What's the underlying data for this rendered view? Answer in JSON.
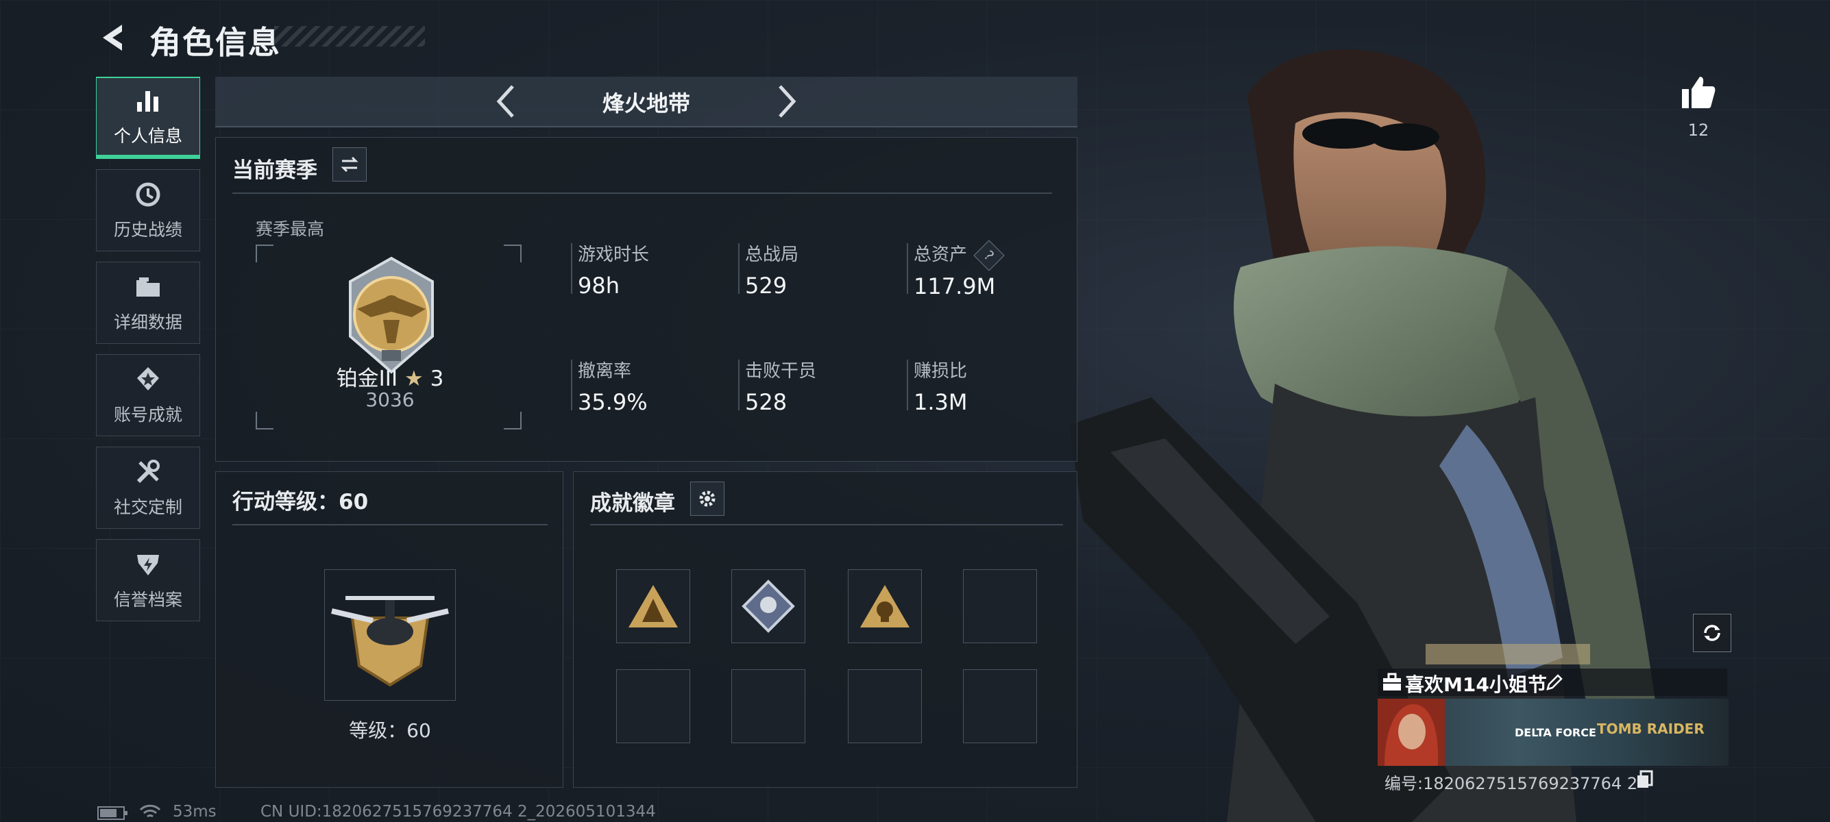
{
  "header": {
    "title": "角色信息"
  },
  "nav": {
    "items": [
      {
        "label": "个人信息",
        "icon": "bar-chart-icon",
        "active": true
      },
      {
        "label": "历史战绩",
        "icon": "history-icon",
        "active": false
      },
      {
        "label": "详细数据",
        "icon": "folder-icon",
        "active": false
      },
      {
        "label": "账号成就",
        "icon": "achievement-icon",
        "active": false
      },
      {
        "label": "社交定制",
        "icon": "tools-icon",
        "active": false
      },
      {
        "label": "信誉档案",
        "icon": "credit-icon",
        "active": false
      }
    ]
  },
  "mode_selector": {
    "title": "烽火地带"
  },
  "season": {
    "title": "当前赛季",
    "best_label": "赛季最高",
    "rank_name": "铂金III",
    "rank_stars": "3",
    "rank_score": "3036",
    "stats": [
      {
        "label": "游戏时长",
        "value": "98h"
      },
      {
        "label": "总战局",
        "value": "529"
      },
      {
        "label": "总资产",
        "value": "117.9M",
        "help": "?"
      },
      {
        "label": "撤离率",
        "value": "35.9%"
      },
      {
        "label": "击败干员",
        "value": "528"
      },
      {
        "label": "赚损比",
        "value": "1.3M"
      }
    ]
  },
  "level": {
    "title": "行动等级：60",
    "label": "等级：60"
  },
  "achievements": {
    "title": "成就徽章",
    "slots_filled": 3,
    "slots_total": 8
  },
  "profile": {
    "likes": "12",
    "nickname": "喜欢M14小姐节",
    "uid": "编号:1820627515769237764 2",
    "banner_text": [
      "DELTA FORCE",
      "TOMB RAIDER"
    ]
  },
  "status_bar": {
    "ping": "53ms",
    "uid_line": "CN UID:1820627515769237764 2_202605101344"
  },
  "colors": {
    "accent": "#3fd19a",
    "gold": "#c9a25a"
  }
}
